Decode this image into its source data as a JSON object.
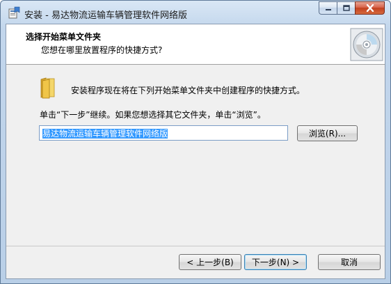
{
  "window": {
    "title": "安装 - 易达物流运输车辆管理软件网络版",
    "icon": "installer-icon",
    "controls": [
      "minimize-icon",
      "maximize-icon",
      "close-icon"
    ]
  },
  "header": {
    "title": "选择开始菜单文件夹",
    "subtitle": "您想在哪里放置程序的快捷方式?",
    "image": "disc-icon"
  },
  "body": {
    "info_text": "安装程序现在将在下列开始菜单文件夹中创建程序的快捷方式。",
    "hint_text": "单击“下一步”继续。如果您想选择其它文件夹，单击“浏览”。",
    "folder_value": "易达物流运输车辆管理软件网络版",
    "browse_label": "浏览(R)..."
  },
  "footer": {
    "back_label": "< 上一步(B)",
    "next_label": "下一步(N) >",
    "cancel_label": "取消"
  },
  "colors": {
    "selection": "#3399ff",
    "close_button": "#c2401f",
    "title_bar": "#c2d6ec"
  }
}
